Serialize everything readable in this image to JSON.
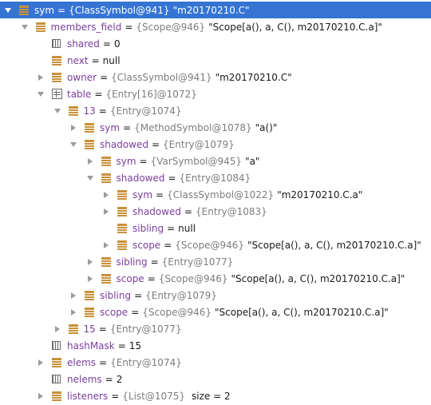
{
  "rows": [
    {
      "name": "sym",
      "ref": "{ClassSymbol@941}",
      "str": "\"m20170210.C\"",
      "toggle": "down",
      "icon": "field",
      "depth": 0,
      "selected": true
    },
    {
      "name": "members_field",
      "ref": "{Scope@946}",
      "str": "\"Scope[a(), a, C(), m20170210.C.a]\"",
      "toggle": "down",
      "icon": "field",
      "depth": 1
    },
    {
      "name": "shared",
      "val": "0",
      "toggle": "none",
      "icon": "prim",
      "depth": 2
    },
    {
      "name": "next",
      "val": "null",
      "toggle": "none",
      "icon": "field",
      "depth": 2
    },
    {
      "name": "owner",
      "ref": "{ClassSymbol@941}",
      "str": "\"m20170210.C\"",
      "toggle": "right",
      "icon": "field",
      "depth": 2
    },
    {
      "name": "table",
      "ref": "{Entry[16]@1072}",
      "toggle": "down",
      "icon": "array",
      "depth": 2
    },
    {
      "name": "13",
      "ref": "{Entry@1074}",
      "toggle": "down",
      "icon": "field",
      "depth": 3
    },
    {
      "name": "sym",
      "ref": "{MethodSymbol@1078}",
      "str": "\"a()\"",
      "toggle": "right",
      "icon": "field",
      "depth": 4
    },
    {
      "name": "shadowed",
      "ref": "{Entry@1079}",
      "toggle": "down",
      "icon": "field",
      "depth": 4
    },
    {
      "name": "sym",
      "ref": "{VarSymbol@945}",
      "str": "\"a\"",
      "toggle": "right",
      "icon": "field",
      "depth": 5
    },
    {
      "name": "shadowed",
      "ref": "{Entry@1084}",
      "toggle": "down",
      "icon": "field",
      "depth": 5
    },
    {
      "name": "sym",
      "ref": "{ClassSymbol@1022}",
      "str": "\"m20170210.C.a\"",
      "toggle": "right",
      "icon": "field",
      "depth": 6
    },
    {
      "name": "shadowed",
      "ref": "{Entry@1083}",
      "toggle": "right",
      "icon": "field",
      "depth": 6
    },
    {
      "name": "sibling",
      "val": "null",
      "toggle": "none",
      "icon": "field",
      "depth": 6
    },
    {
      "name": "scope",
      "ref": "{Scope@946}",
      "str": "\"Scope[a(), a, C(), m20170210.C.a]\"",
      "toggle": "right",
      "icon": "field",
      "depth": 6
    },
    {
      "name": "sibling",
      "ref": "{Entry@1077}",
      "toggle": "right",
      "icon": "field",
      "depth": 5
    },
    {
      "name": "scope",
      "ref": "{Scope@946}",
      "str": "\"Scope[a(), a, C(), m20170210.C.a]\"",
      "toggle": "right",
      "icon": "field",
      "depth": 5
    },
    {
      "name": "sibling",
      "ref": "{Entry@1079}",
      "toggle": "right",
      "icon": "field",
      "depth": 4
    },
    {
      "name": "scope",
      "ref": "{Scope@946}",
      "str": "\"Scope[a(), a, C(), m20170210.C.a]\"",
      "toggle": "right",
      "icon": "field",
      "depth": 4
    },
    {
      "name": "15",
      "ref": "{Entry@1077}",
      "toggle": "right",
      "icon": "field",
      "depth": 3
    },
    {
      "name": "hashMask",
      "val": "15",
      "toggle": "none",
      "icon": "prim",
      "depth": 2
    },
    {
      "name": "elems",
      "ref": "{Entry@1074}",
      "toggle": "right",
      "icon": "field",
      "depth": 2
    },
    {
      "name": "nelems",
      "val": "2",
      "toggle": "none",
      "icon": "prim",
      "depth": 2
    },
    {
      "name": "listeners",
      "ref": "{List@1075}",
      "extra": "size = 2",
      "toggle": "right",
      "icon": "field",
      "depth": 2
    }
  ]
}
